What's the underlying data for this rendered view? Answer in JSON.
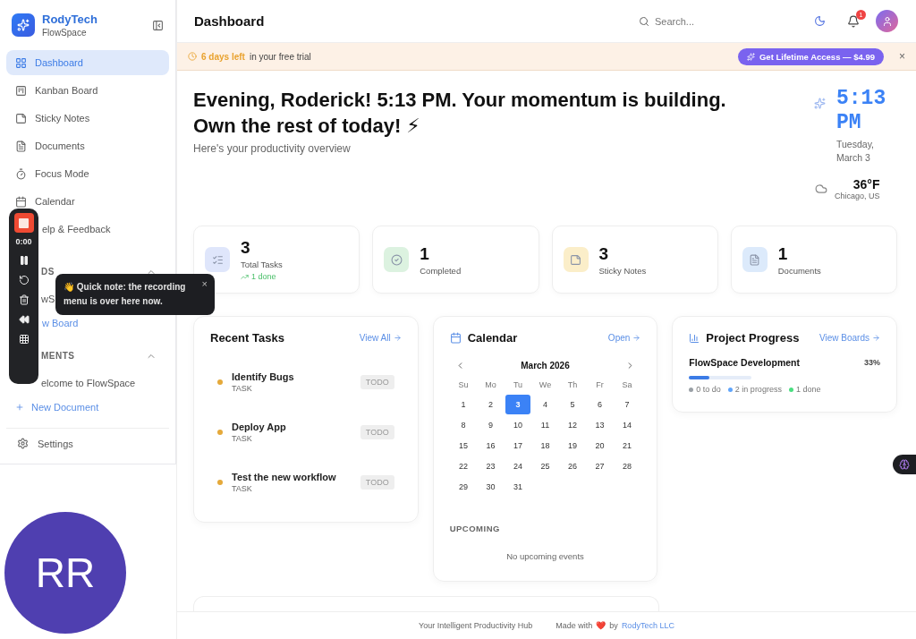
{
  "brand": {
    "name": "RodyTech",
    "product": "FlowSpace"
  },
  "nav": [
    {
      "label": "Dashboard",
      "selected": true
    },
    {
      "label": "Kanban Board",
      "selected": false
    },
    {
      "label": "Sticky Notes",
      "selected": false
    },
    {
      "label": "Documents",
      "selected": false
    },
    {
      "label": "Focus Mode",
      "selected": false
    },
    {
      "label": "Calendar",
      "selected": false
    },
    {
      "label": "elp & Feedback",
      "selected": false
    }
  ],
  "sections": [
    {
      "title": "DS",
      "items": [
        {
          "label": "wS",
          "kind": "entry"
        },
        {
          "label": "w Board",
          "kind": "add"
        }
      ]
    },
    {
      "title": "MENTS",
      "items": [
        {
          "label": "elcome to FlowSpace",
          "kind": "entry"
        },
        {
          "label": "New Document",
          "kind": "add"
        }
      ]
    }
  ],
  "settings": {
    "label": "Settings"
  },
  "header": {
    "title": "Dashboard",
    "search": {
      "placeholder": "Search..."
    },
    "notification_count": "1"
  },
  "trial": {
    "highlight": "6 days left",
    "text": "in your free trial",
    "button": "Get Lifetime Access — $4.99",
    "close": "×"
  },
  "greeting": {
    "title": "Evening, Roderick! 5:13 PM. Your momentum is building. Own the rest of today! ⚡",
    "subtitle": "Here's your productivity overview"
  },
  "clock": {
    "time": "5:13 PM",
    "date": "Tuesday, March 3",
    "temperature": "36°F",
    "location": "Chicago, US"
  },
  "stats": [
    {
      "value": "3",
      "label": "Total Tasks",
      "note": "1 done",
      "color": "#dfe6fb"
    },
    {
      "value": "1",
      "label": "Completed",
      "color": "#dcf2e0"
    },
    {
      "value": "3",
      "label": "Sticky Notes",
      "color": "#fbeec9"
    },
    {
      "value": "1",
      "label": "Documents",
      "color": "#dceafb"
    }
  ],
  "recent_tasks": {
    "title": "Recent Tasks",
    "link": "View All",
    "tasks": [
      {
        "title": "Identify Bugs",
        "type": "TASK",
        "status": "TODO",
        "color": "#e5a93a"
      },
      {
        "title": "Deploy App",
        "type": "TASK",
        "status": "TODO",
        "color": "#e5a93a"
      },
      {
        "title": "Test the new workflow",
        "type": "TASK",
        "status": "TODO",
        "color": "#e5a93a"
      }
    ]
  },
  "calendar": {
    "title": "Calendar",
    "link": "Open",
    "month": "March 2026",
    "weekdays": [
      "Su",
      "Mo",
      "Tu",
      "We",
      "Th",
      "Fr",
      "Sa"
    ],
    "days": [
      {
        "day": "1",
        "selected": false
      },
      {
        "day": "2",
        "selected": false
      },
      {
        "day": "3",
        "selected": true
      },
      {
        "day": "4",
        "selected": false
      },
      {
        "day": "5",
        "selected": false
      },
      {
        "day": "6",
        "selected": false
      },
      {
        "day": "7",
        "selected": false
      },
      {
        "day": "8",
        "selected": false
      },
      {
        "day": "9",
        "selected": false
      },
      {
        "day": "10",
        "selected": false
      },
      {
        "day": "11",
        "selected": false
      },
      {
        "day": "12",
        "selected": false
      },
      {
        "day": "13",
        "selected": false
      },
      {
        "day": "14",
        "selected": false
      },
      {
        "day": "15",
        "selected": false
      },
      {
        "day": "16",
        "selected": false
      },
      {
        "day": "17",
        "selected": false
      },
      {
        "day": "18",
        "selected": false
      },
      {
        "day": "19",
        "selected": false
      },
      {
        "day": "20",
        "selected": false
      },
      {
        "day": "21",
        "selected": false
      },
      {
        "day": "22",
        "selected": false
      },
      {
        "day": "23",
        "selected": false
      },
      {
        "day": "24",
        "selected": false
      },
      {
        "day": "25",
        "selected": false
      },
      {
        "day": "26",
        "selected": false
      },
      {
        "day": "27",
        "selected": false
      },
      {
        "day": "28",
        "selected": false
      },
      {
        "day": "29",
        "selected": false
      },
      {
        "day": "30",
        "selected": false
      },
      {
        "day": "31",
        "selected": false
      }
    ],
    "upcoming_title": "UPCOMING",
    "upcoming_empty": "No upcoming events"
  },
  "project_progress": {
    "title": "Project Progress",
    "link": "View Boards",
    "projects": [
      {
        "name": "FlowSpace Development",
        "percent": "33%",
        "level": 0.33,
        "legend": [
          {
            "label": "0 to do",
            "color": "#9aa0a6"
          },
          {
            "label": "2 in progress",
            "color": "#60a5fa"
          },
          {
            "label": "1 done",
            "color": "#4ade80"
          }
        ]
      }
    ]
  },
  "footer": {
    "tagline": "Your Intelligent Productivity Hub",
    "made_with": "Made with",
    "heart": "❤️",
    "by": "by",
    "company": "RodyTech LLC"
  },
  "recorder": {
    "time": "0:00",
    "tooltip": "👋 Quick note: the recording menu is over here now.",
    "tooltip_close": "×"
  },
  "user_badge": {
    "initials": "RR"
  }
}
